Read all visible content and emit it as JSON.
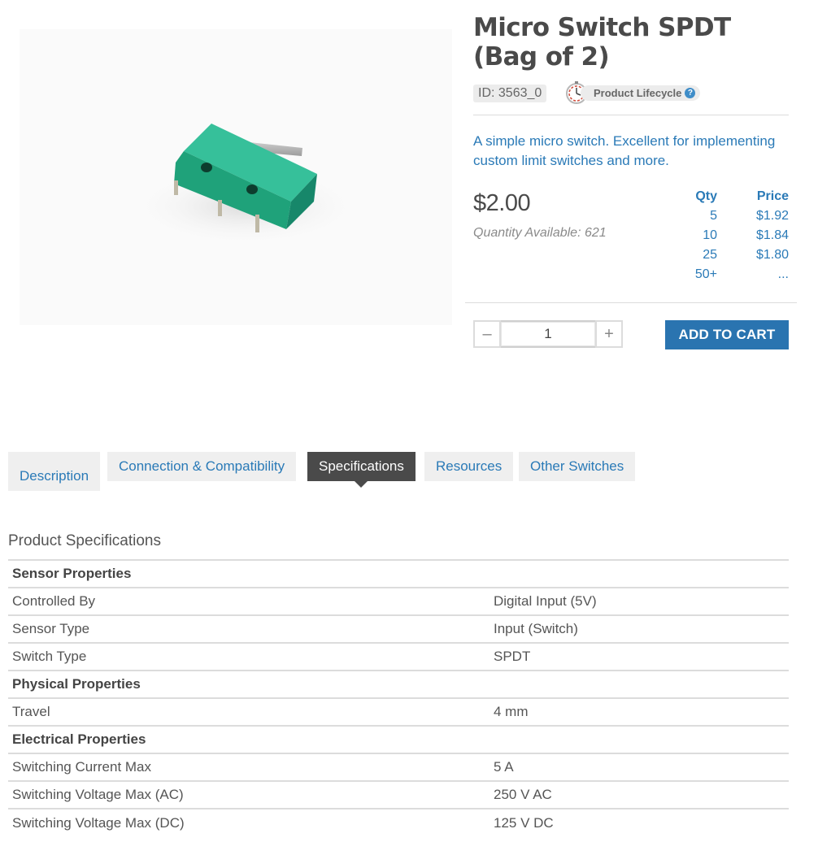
{
  "product": {
    "title": "Micro Switch SPDT (Bag of 2)",
    "id_label": "ID: 3563_0",
    "lifecycle_label": "Product Lifecycle",
    "help_glyph": "?",
    "short_description": "A simple micro switch. Excellent for implementing custom limit switches and more.",
    "price": "$2.00",
    "quantity_available": "Quantity Available: 621"
  },
  "price_breaks": {
    "headers": {
      "qty": "Qty",
      "price": "Price"
    },
    "rows": [
      {
        "qty": "5",
        "price": "$1.92"
      },
      {
        "qty": "10",
        "price": "$1.84"
      },
      {
        "qty": "25",
        "price": "$1.80"
      },
      {
        "qty": "50+",
        "price": "..."
      }
    ]
  },
  "cart": {
    "minus": "–",
    "plus": "+",
    "quantity": "1",
    "add_label": "ADD TO CART"
  },
  "tabs": [
    {
      "label": "Description"
    },
    {
      "label": "Connection & Compatibility"
    },
    {
      "label": "Specifications",
      "active": true
    },
    {
      "label": "Resources"
    },
    {
      "label": "Other Switches"
    }
  ],
  "specs": {
    "heading": "Product Specifications",
    "rows": [
      {
        "group": "Sensor Properties"
      },
      {
        "key": "Controlled By",
        "value": "Digital Input (5V)"
      },
      {
        "key": "Sensor Type",
        "value": "Input (Switch)"
      },
      {
        "key": "Switch Type",
        "value": "SPDT"
      },
      {
        "group": "Physical Properties"
      },
      {
        "key": "Travel",
        "value": "4 mm"
      },
      {
        "group": "Electrical Properties"
      },
      {
        "key": "Switching Current Max",
        "value": "5 A"
      },
      {
        "key": "Switching Voltage Max (AC)",
        "value": "250 V AC"
      },
      {
        "key": "Switching Voltage Max (DC)",
        "value": "125 V DC"
      }
    ]
  },
  "colors": {
    "link_blue": "#2a7ab7",
    "button_blue": "#2a74b0",
    "active_tab": "#4a4a4a",
    "switch_green": "#1fa27a"
  }
}
